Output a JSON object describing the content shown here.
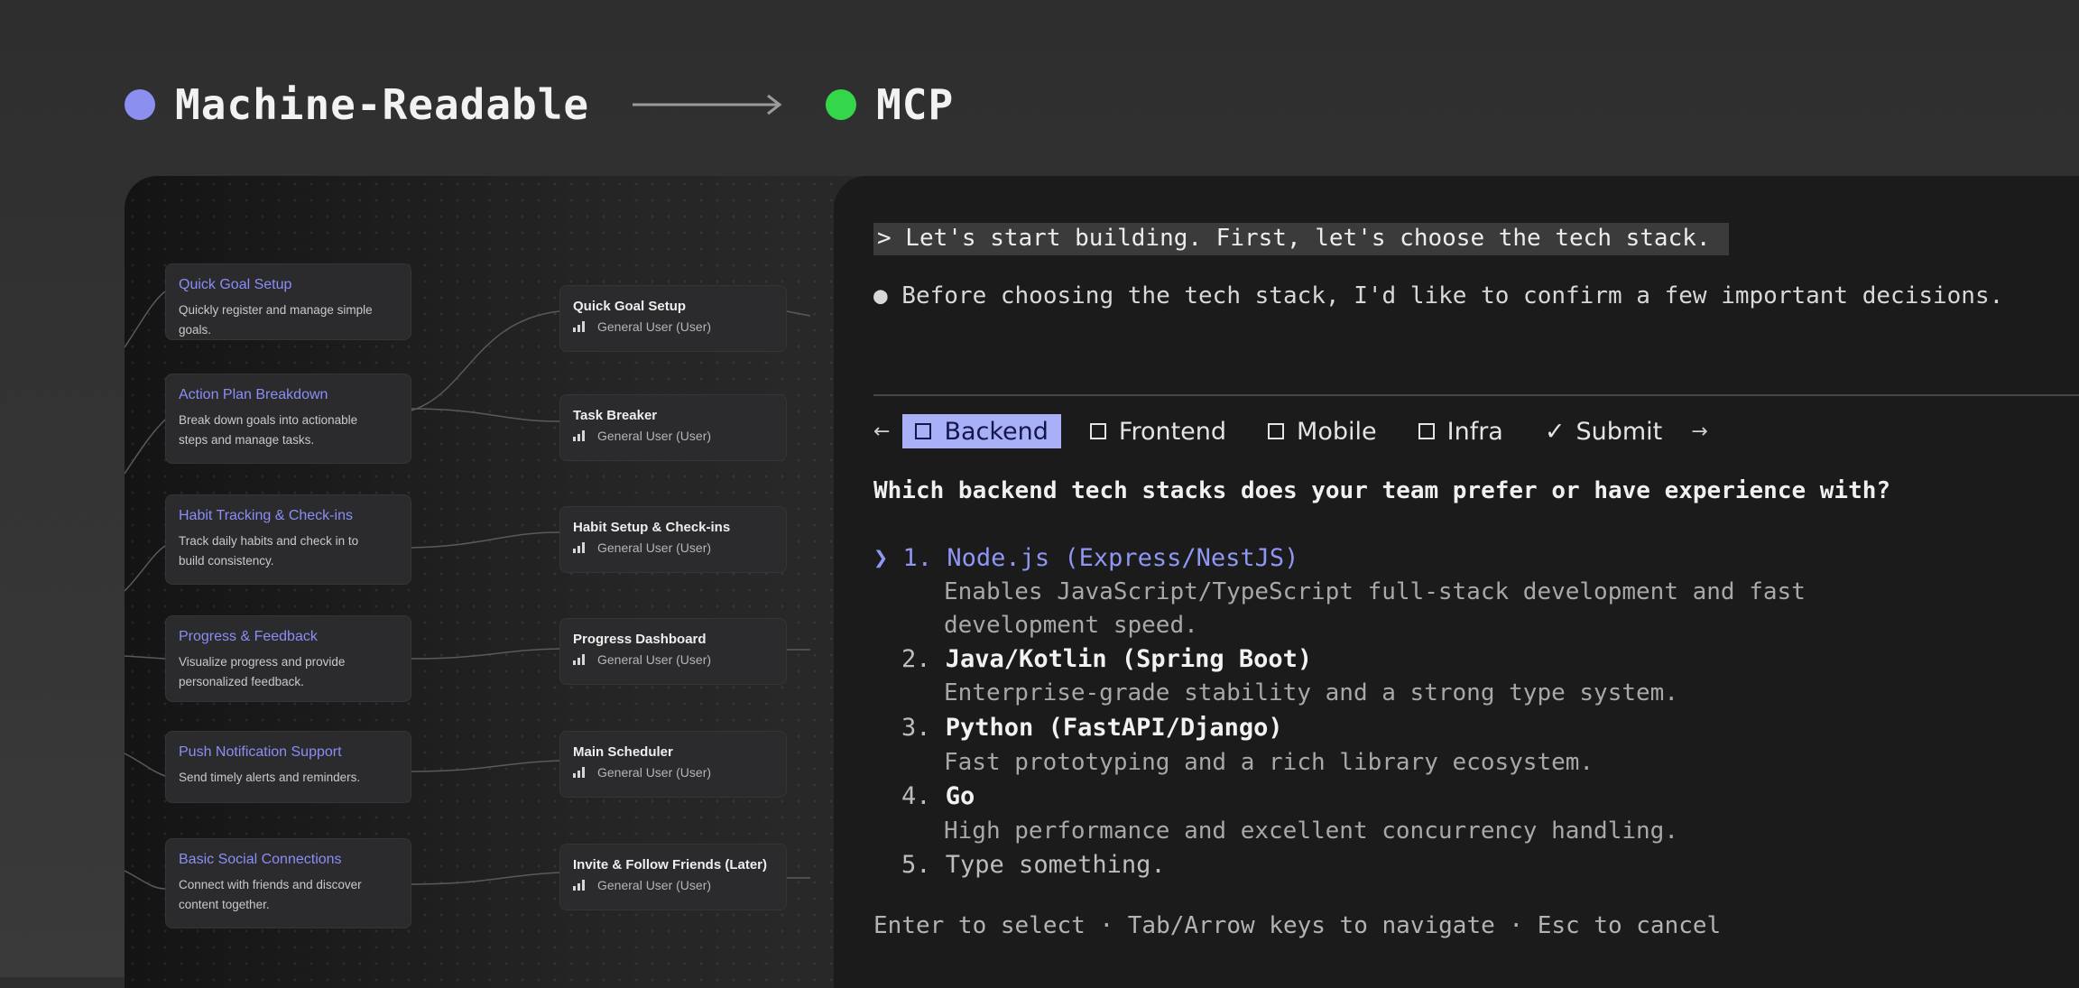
{
  "header": {
    "left_title": "Machine-Readable",
    "right_title": "MCP",
    "left_dot_color": "#8a8ff0",
    "right_dot_color": "#34d64a"
  },
  "features": [
    {
      "title": "Quick Goal Setup",
      "desc": [
        "Quickly register and manage simple goals."
      ]
    },
    {
      "title": "Action Plan Breakdown",
      "desc": [
        "Break down goals into actionable",
        "steps and manage tasks."
      ]
    },
    {
      "title": "Habit Tracking & Check-ins",
      "desc": [
        "Track daily habits and check in to",
        "build consistency."
      ]
    },
    {
      "title": "Progress & Feedback",
      "desc": [
        "Visualize progress and provide",
        "personalized feedback."
      ]
    },
    {
      "title": "Push Notification Support",
      "desc": [
        "Send timely alerts and reminders."
      ]
    },
    {
      "title": "Basic Social Connections",
      "desc": [
        "Connect with friends and discover",
        "content together."
      ]
    }
  ],
  "screens": [
    {
      "title": "Quick Goal Setup",
      "role": "General User (User)"
    },
    {
      "title": "Task Breaker",
      "role": "General User (User)"
    },
    {
      "title": "Habit Setup & Check-ins",
      "role": "General User (User)"
    },
    {
      "title": "Progress Dashboard",
      "role": "General User (User)"
    },
    {
      "title": "Main Scheduler",
      "role": "General User (User)"
    },
    {
      "title": "Invite & Follow Friends (Later)",
      "role": "General User (User)"
    }
  ],
  "terminal": {
    "prompt": "> Let's start building. First, let's choose the tech stack.",
    "bullet": "● Before choosing the tech stack, I'd like to confirm a few important decisions.",
    "tab_left_arrow": "←",
    "tab_right_arrow": "→",
    "tabs": [
      {
        "label": "Backend",
        "selected": true
      },
      {
        "label": "Frontend",
        "selected": false
      },
      {
        "label": "Mobile",
        "selected": false
      },
      {
        "label": "Infra",
        "selected": false
      }
    ],
    "submit_label": "Submit",
    "submit_mark": "✓",
    "question": "Which backend tech stacks does your team prefer or have experience with?",
    "selector": "❯",
    "options": [
      {
        "num": "1.",
        "name": "Node.js (Express/NestJS)",
        "desc": [
          "Enables JavaScript/TypeScript full-stack development and fast",
          "development speed."
        ]
      },
      {
        "num": "2.",
        "name": "Java/Kotlin (Spring Boot)",
        "desc": [
          "Enterprise-grade stability and a strong type system."
        ]
      },
      {
        "num": "3.",
        "name": "Python (FastAPI/Django)",
        "desc": [
          "Fast prototyping and a rich library ecosystem."
        ]
      },
      {
        "num": "4.",
        "name": "Go",
        "desc": [
          "High performance and excellent concurrency handling."
        ]
      },
      {
        "num": "5.",
        "name": "Type something.",
        "desc": []
      }
    ],
    "footer": "Enter to select · Tab/Arrow keys to navigate · Esc to cancel"
  }
}
